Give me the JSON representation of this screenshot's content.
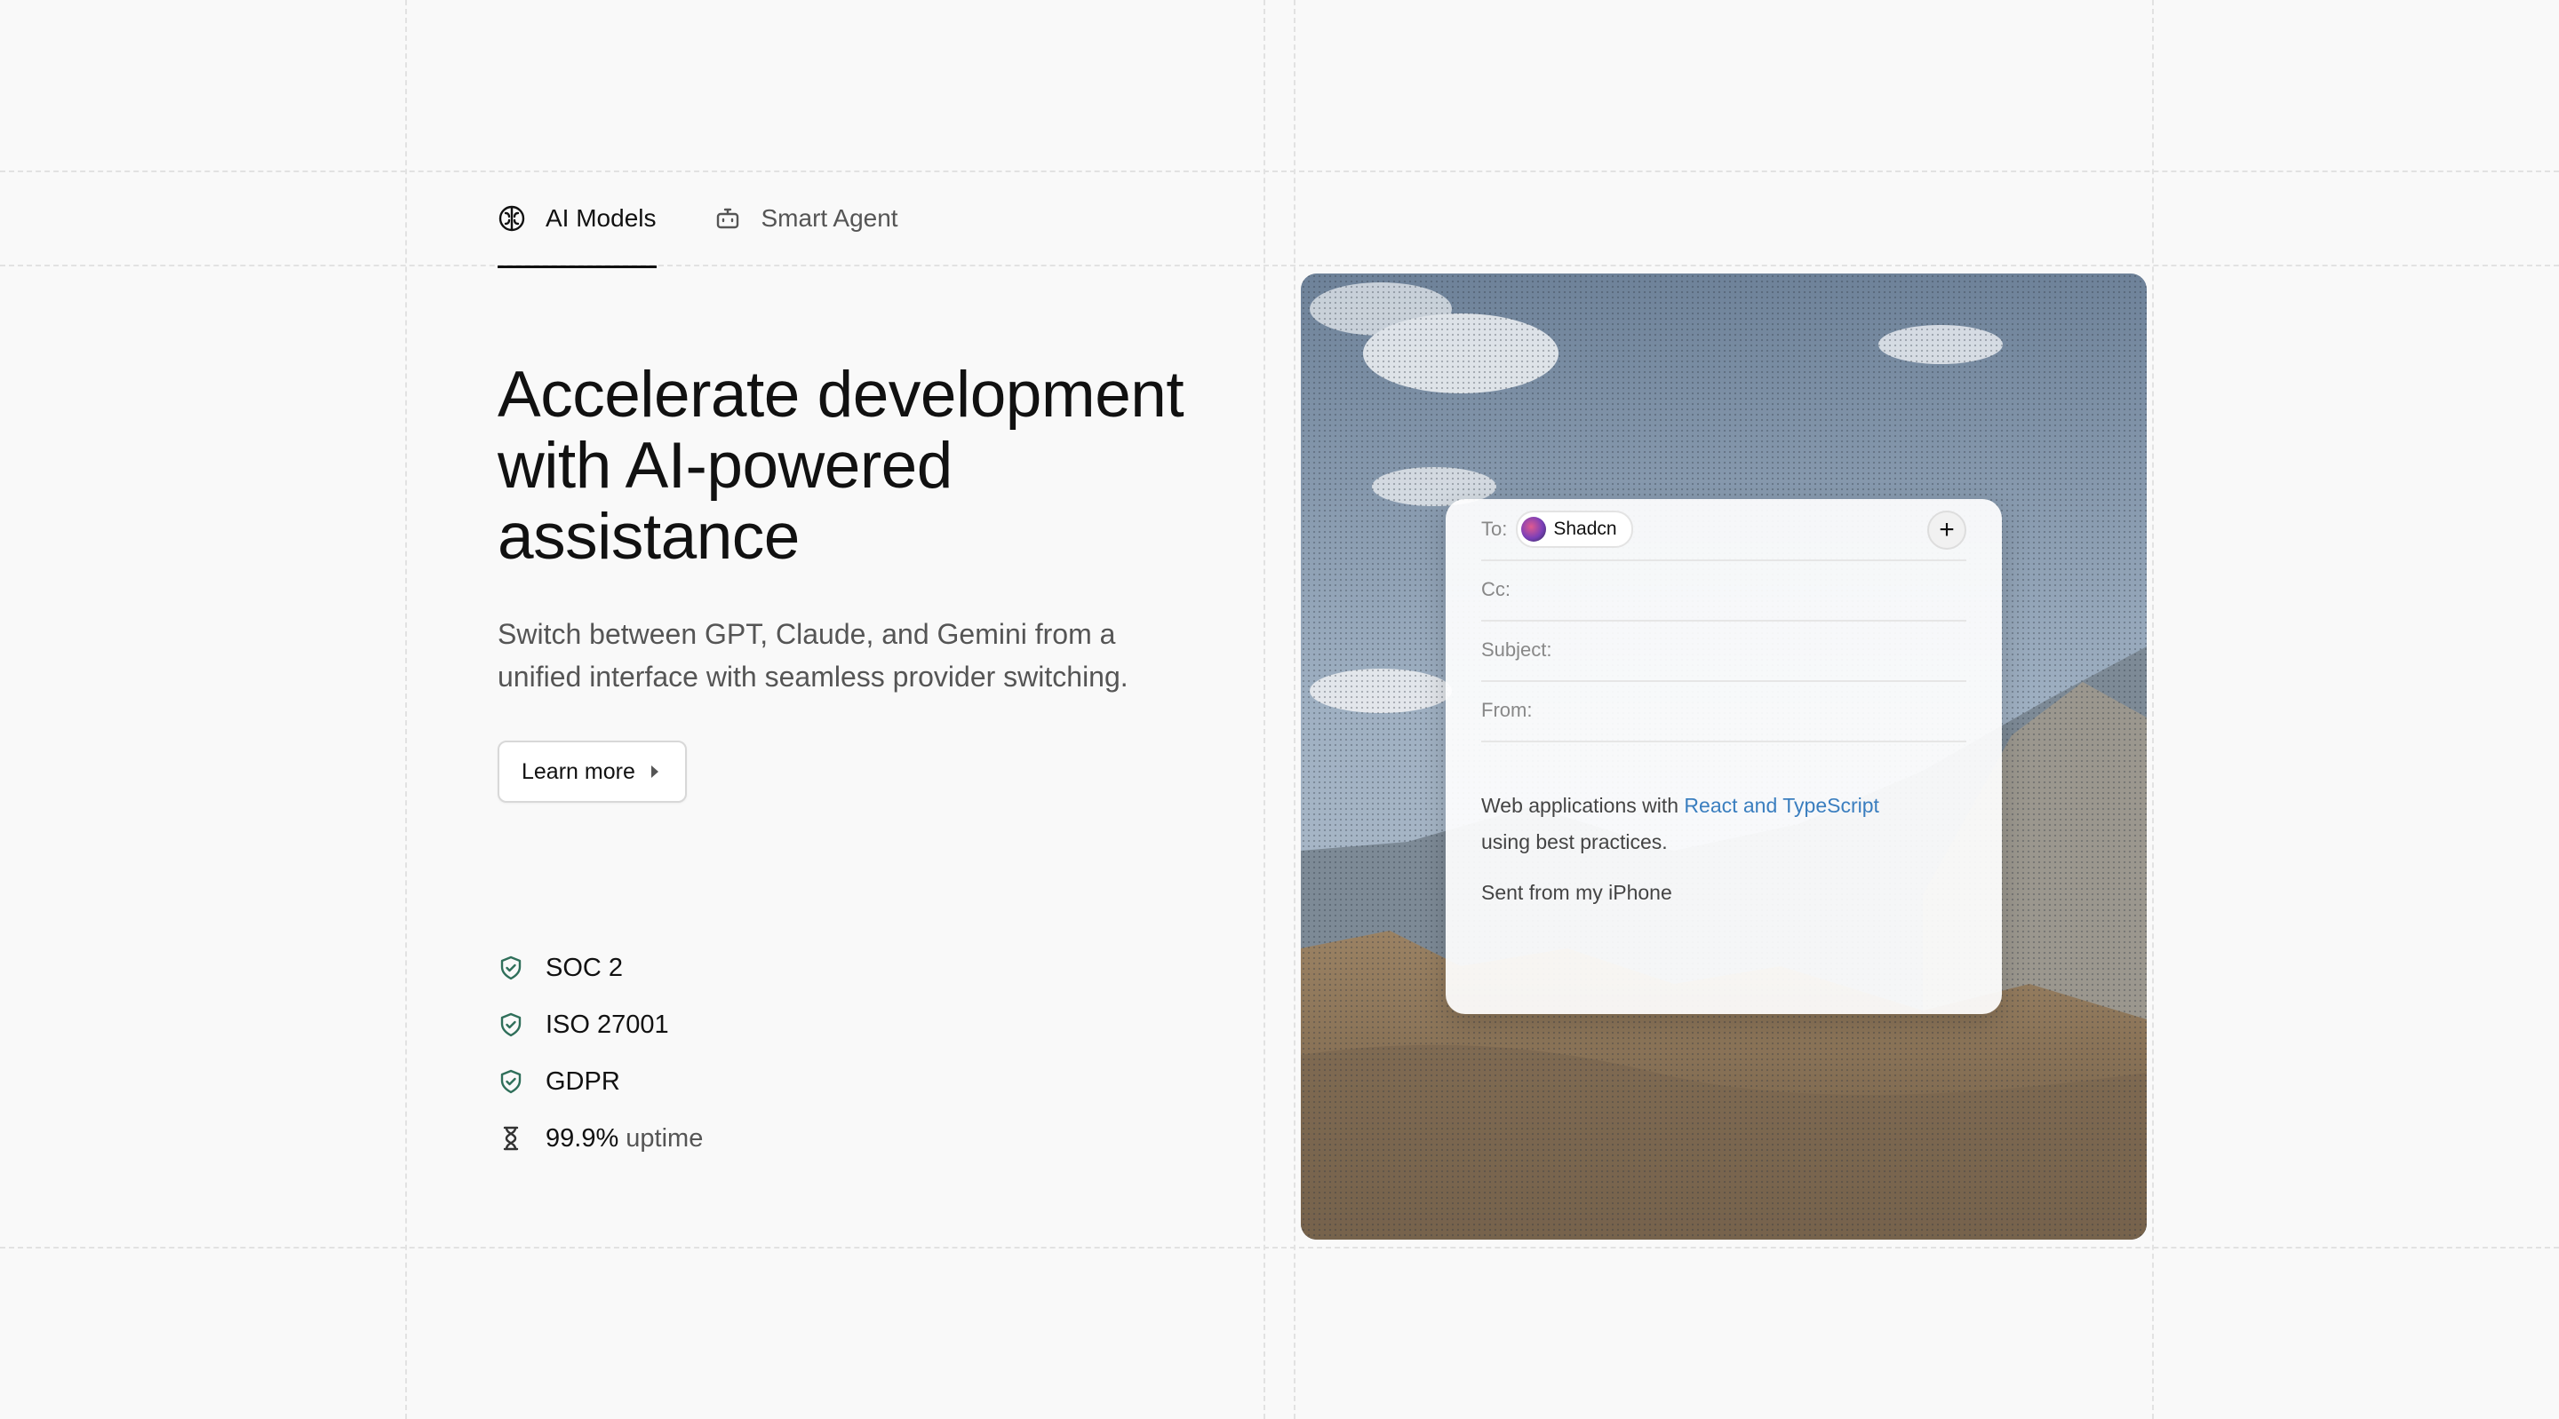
{
  "tabs": [
    {
      "label": "AI Models",
      "icon": "brain-icon",
      "active": true
    },
    {
      "label": "Smart Agent",
      "icon": "bot-icon",
      "active": false
    }
  ],
  "headline": "Accelerate development with AI-powered assistance",
  "subtitle": "Switch between GPT, Claude, and Gemini from a unified interface with seamless provider switching.",
  "learn_more_label": "Learn more",
  "badges": [
    {
      "label": "SOC 2",
      "icon": "shield-check-icon"
    },
    {
      "label": "ISO 27001",
      "icon": "shield-check-icon"
    },
    {
      "label": "GDPR",
      "icon": "shield-check-icon"
    },
    {
      "value": "99.9%",
      "label": "uptime",
      "icon": "hourglass-icon"
    }
  ],
  "mail": {
    "to_label": "To:",
    "recipient": "Shadcn",
    "cc_label": "Cc:",
    "subject_label": "Subject:",
    "from_label": "From:",
    "body_prefix": "Web applications with",
    "body_link": "React and TypeScript",
    "body_suffix": "using best practices.",
    "signature": "Sent from my iPhone",
    "add_label": "+"
  },
  "colors": {
    "background": "#f9f9f9",
    "text": "#111111",
    "muted": "#555555",
    "link": "#3a7ebf",
    "shield": "#2f6f5a"
  }
}
